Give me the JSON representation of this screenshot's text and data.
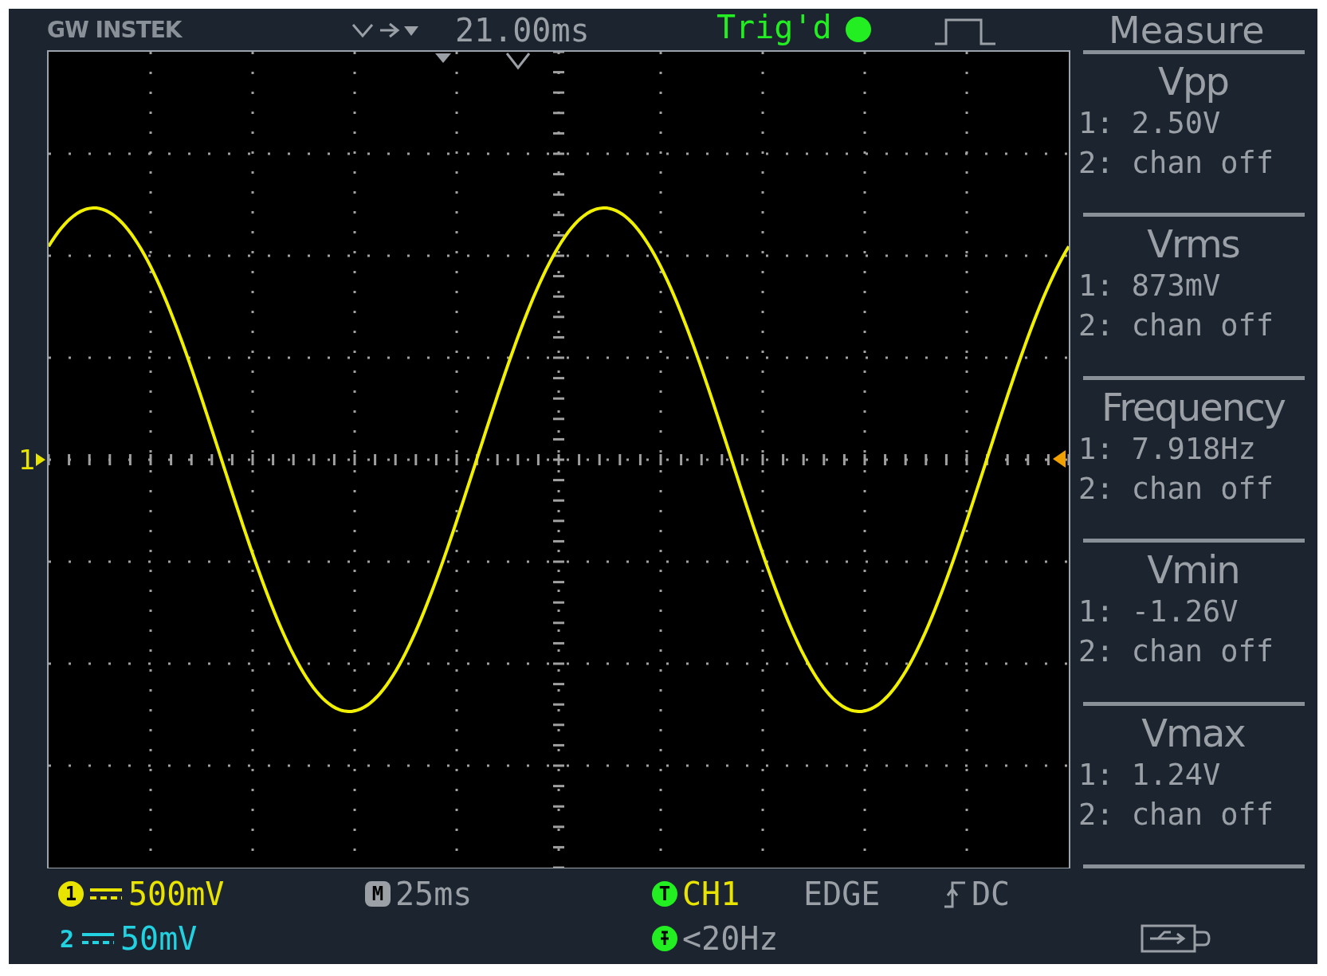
{
  "header": {
    "logo": "GW INSTEK",
    "trigger_position": "21.00ms",
    "trigger_status": "Trig'd",
    "menu_title": "Measure"
  },
  "waveform": {
    "channel_marker": "1"
  },
  "measurements": [
    {
      "name": "Vpp",
      "ch1": "1: 2.50V",
      "ch2": "2: chan off"
    },
    {
      "name": "Vrms",
      "ch1": "1: 873mV",
      "ch2": "2: chan off"
    },
    {
      "name": "Frequency",
      "ch1": "1: 7.918Hz",
      "ch2": "2: chan off"
    },
    {
      "name": "Vmin",
      "ch1": "1: -1.26V",
      "ch2": "2: chan off"
    },
    {
      "name": "Vmax",
      "ch1": "1: 1.24V",
      "ch2": "2: chan off"
    }
  ],
  "status": {
    "channels": [
      {
        "badge": "1",
        "scale": "500mV",
        "color": "#e8e400"
      },
      {
        "badge": "2",
        "scale": "50mV",
        "color": "#22d2e0"
      }
    ],
    "timebase": {
      "badge": "M",
      "value": "25ms"
    },
    "trigger": {
      "badge": "T",
      "source": "CH1",
      "type": "EDGE",
      "coupling": "DC"
    },
    "filter": "<20Hz"
  }
}
